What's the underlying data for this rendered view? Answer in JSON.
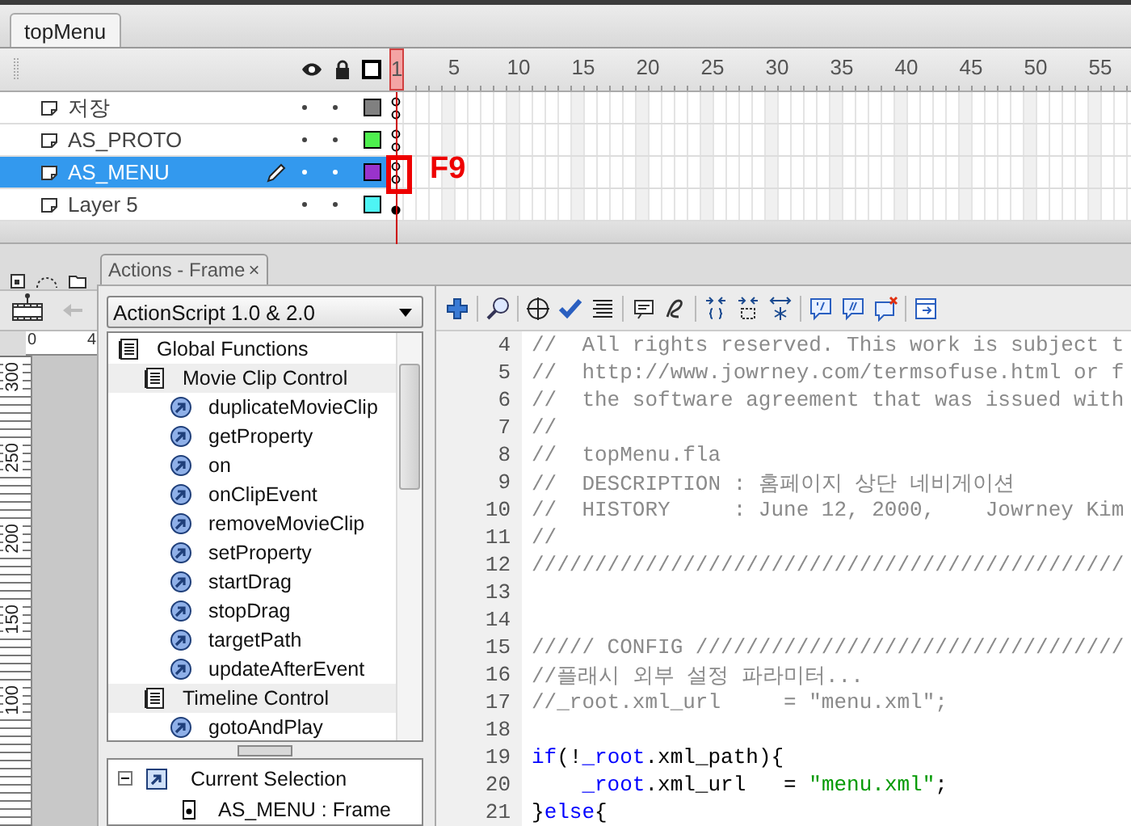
{
  "document_tab": {
    "label": "topMenu",
    "selected": true
  },
  "timeline": {
    "ruler": [
      "1",
      "5",
      "10",
      "15",
      "20",
      "25",
      "30",
      "35",
      "40",
      "45",
      "50",
      "55"
    ],
    "layers": [
      {
        "name": "저장",
        "selected": false,
        "color": "#808080",
        "keyframe_filled": false
      },
      {
        "name": "AS_PROTO",
        "selected": false,
        "color": "#4ef04e",
        "keyframe_filled": false
      },
      {
        "name": "AS_MENU",
        "selected": true,
        "color": "#9933cc",
        "keyframe_filled": false
      },
      {
        "name": "Layer 5",
        "selected": false,
        "color": "#4ef4f4",
        "keyframe_filled": true
      }
    ],
    "annotation": {
      "text": "F9"
    }
  },
  "stage": {
    "horizontal_ruler": [
      "0",
      "4"
    ],
    "vertical_ruler": [
      "300",
      "250",
      "200",
      "150",
      "100"
    ]
  },
  "actions_panel": {
    "tab": {
      "title": "Actions - Frame",
      "close": "×"
    },
    "language_menu": "ActionScript 1.0 & 2.0",
    "toolbox": [
      {
        "kind": "book",
        "label": "Global Functions",
        "children": [
          {
            "kind": "book",
            "label": "Movie Clip Control",
            "children": [
              {
                "kind": "action",
                "label": "duplicateMovieClip"
              },
              {
                "kind": "action",
                "label": "getProperty"
              },
              {
                "kind": "action",
                "label": "on"
              },
              {
                "kind": "action",
                "label": "onClipEvent"
              },
              {
                "kind": "action",
                "label": "removeMovieClip"
              },
              {
                "kind": "action",
                "label": "setProperty"
              },
              {
                "kind": "action",
                "label": "startDrag"
              },
              {
                "kind": "action",
                "label": "stopDrag"
              },
              {
                "kind": "action",
                "label": "targetPath"
              },
              {
                "kind": "action",
                "label": "updateAfterEvent"
              }
            ]
          },
          {
            "kind": "book",
            "label": "Timeline Control",
            "children": [
              {
                "kind": "action",
                "label": "gotoAndPlay"
              }
            ]
          }
        ]
      }
    ],
    "script_navigator": [
      {
        "kind": "selection",
        "label": "Current Selection",
        "expanded": true,
        "children": [
          {
            "kind": "frame",
            "label": "AS_MENU : Frame"
          }
        ]
      }
    ],
    "code_lines": [
      {
        "number": "4",
        "tokens": [
          {
            "kind": "comment",
            "text": "//  All rights reserved. This work is subject t"
          }
        ]
      },
      {
        "number": "5",
        "tokens": [
          {
            "kind": "comment",
            "text": "//  http://www.jowrney.com/termsofuse.html or f"
          }
        ]
      },
      {
        "number": "6",
        "tokens": [
          {
            "kind": "comment",
            "text": "//  the software agreement that was issued with"
          }
        ]
      },
      {
        "number": "7",
        "tokens": [
          {
            "kind": "comment",
            "text": "//"
          }
        ]
      },
      {
        "number": "8",
        "tokens": [
          {
            "kind": "comment",
            "text": "//  topMenu.fla"
          }
        ]
      },
      {
        "number": "9",
        "tokens": [
          {
            "kind": "comment",
            "text": "//  DESCRIPTION : 홈페이지 상단 네비게이션"
          }
        ]
      },
      {
        "number": "10",
        "tokens": [
          {
            "kind": "comment",
            "text": "//  HISTORY     : June 12, 2000,    Jowrney Kim"
          }
        ]
      },
      {
        "number": "11",
        "tokens": [
          {
            "kind": "comment",
            "text": "//"
          }
        ]
      },
      {
        "number": "12",
        "tokens": [
          {
            "kind": "comment",
            "text": "///////////////////////////////////////////////"
          }
        ]
      },
      {
        "number": "13"
      },
      {
        "number": "14"
      },
      {
        "number": "15",
        "tokens": [
          {
            "kind": "comment",
            "text": "///// CONFIG //////////////////////////////////"
          }
        ]
      },
      {
        "number": "16",
        "tokens": [
          {
            "kind": "comment",
            "text": "//플래시 외부 설정 파라미터..."
          }
        ]
      },
      {
        "number": "17",
        "tokens": [
          {
            "kind": "comment",
            "text": "//_root.xml_url     = \"menu.xml\";"
          }
        ]
      },
      {
        "number": "18"
      },
      {
        "number": "19",
        "tokens": [
          {
            "kind": "keyword",
            "text": "if"
          },
          {
            "kind": "plain",
            "text": "(!"
          },
          {
            "kind": "keyword",
            "text": "_root"
          },
          {
            "kind": "plain",
            "text": ".xml_path){"
          }
        ]
      },
      {
        "number": "20",
        "indented": true,
        "tokens": [
          {
            "kind": "keyword",
            "text": "_root"
          },
          {
            "kind": "plain",
            "text": ".xml_url   = "
          },
          {
            "kind": "string",
            "text": "\"menu.xml\""
          },
          {
            "kind": "plain",
            "text": ";"
          }
        ]
      },
      {
        "number": "21",
        "tokens": [
          {
            "kind": "plain",
            "text": "}"
          },
          {
            "kind": "keyword",
            "text": "else"
          },
          {
            "kind": "plain",
            "text": "{"
          }
        ]
      }
    ]
  }
}
